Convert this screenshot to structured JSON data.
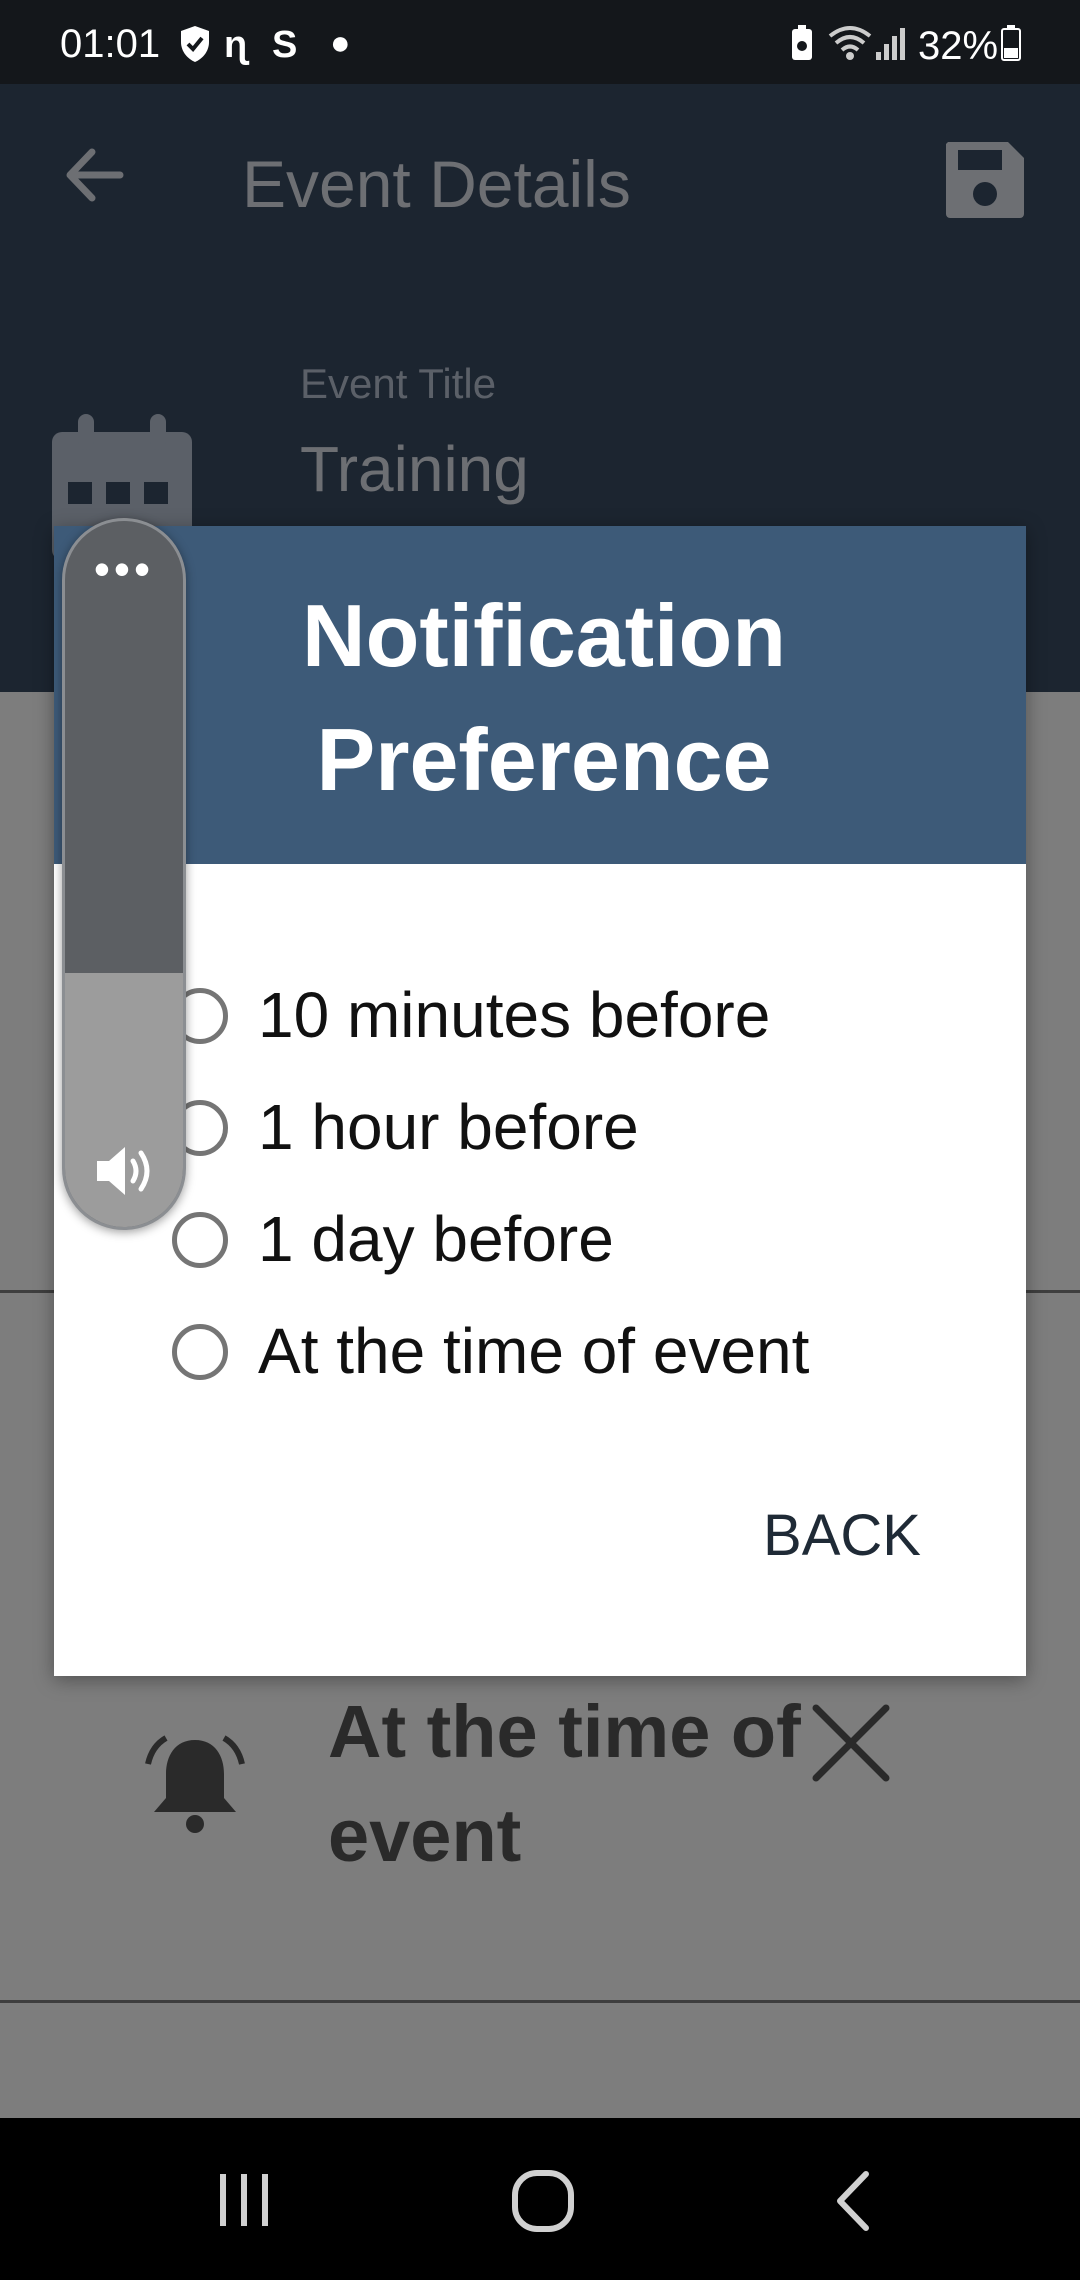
{
  "status_bar": {
    "time": "01:01",
    "battery_pct": "32%",
    "icons": [
      "shield-icon",
      "network-n-icon",
      "s-icon",
      "dot-icon",
      "battery-saver-icon",
      "wifi-icon",
      "signal-icon",
      "battery-icon"
    ]
  },
  "header": {
    "title": "Event Details",
    "back_icon": "back-arrow-icon",
    "save_icon": "save-icon"
  },
  "event": {
    "title_label": "Event Title",
    "title_value": "Training"
  },
  "background": {
    "notification_text": "At the time of event"
  },
  "dialog": {
    "title": "Notification Preference",
    "options": [
      {
        "label": "10 minutes before",
        "selected": false
      },
      {
        "label": "1 hour before",
        "selected": false
      },
      {
        "label": "1 day before",
        "selected": false
      },
      {
        "label": "At the time of event",
        "selected": false
      }
    ],
    "back_label": "BACK"
  },
  "volume_panel": {
    "more_label": "•••",
    "level": 0.36
  },
  "colors": {
    "dialog_header": "#3d5a78",
    "app_header": "#1c2530",
    "scrim": "#7d7d7d"
  }
}
